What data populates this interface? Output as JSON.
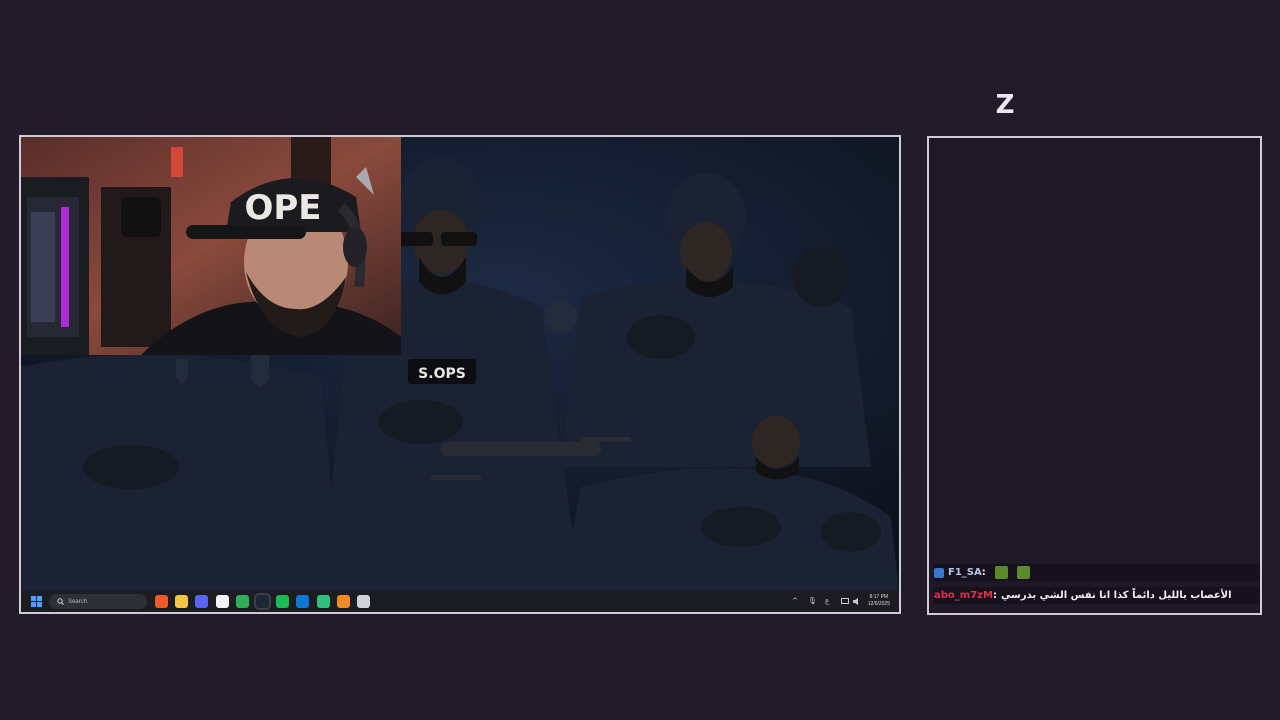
{
  "overlay": {
    "logo_glyph": "Z"
  },
  "screen": {
    "wallpaper": {
      "badge_text": "S.OPS"
    },
    "webcam": {
      "cap_text": "OPE"
    },
    "taskbar": {
      "search_label": "Search",
      "apps": [
        {
          "name": "brave-icon",
          "color": "#f05a28"
        },
        {
          "name": "file-explorer-icon",
          "color": "#f4c542"
        },
        {
          "name": "discord-icon",
          "color": "#5865f2"
        },
        {
          "name": "steelseries-icon",
          "color": "#f2f2f2"
        },
        {
          "name": "chrome-icon",
          "color": "#2fae5a"
        },
        {
          "name": "steam-icon",
          "color": "#1b2838"
        },
        {
          "name": "spotify-icon",
          "color": "#1db954"
        },
        {
          "name": "outlook-icon",
          "color": "#0a78d4"
        },
        {
          "name": "app-green-icon",
          "color": "#2ec27e"
        },
        {
          "name": "app-orange-icon",
          "color": "#f08a24"
        },
        {
          "name": "terminal-icon",
          "color": "#cfd2d8"
        }
      ],
      "tray": {
        "chevron": "^",
        "mic": "🎙",
        "lang": "ع",
        "time": "8:17 PM",
        "date": "12/6/2025"
      }
    }
  },
  "chat": {
    "messages": [
      {
        "user": "F1_SA",
        "separator": " :",
        "text": "",
        "emotes": [
          "pepe-emote-icon",
          "pepe-emote-icon"
        ]
      },
      {
        "user": "abo_m7zM",
        "separator": " :",
        "text": "الأعصاب بالليل دائماً كذا انا نفس الشي بدرسي"
      }
    ]
  }
}
